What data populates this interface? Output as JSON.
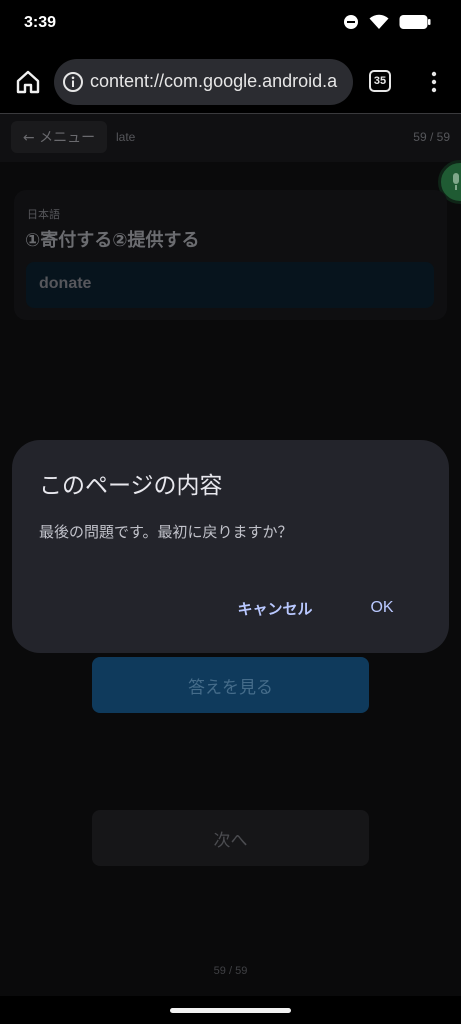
{
  "status_bar": {
    "time": "3:39",
    "icons": [
      "do-not-disturb-icon",
      "wifi-icon",
      "battery-icon"
    ]
  },
  "browser": {
    "url": "content://com.google.android.a",
    "tab_count": "35",
    "icons": [
      "home-icon",
      "site-info-icon",
      "tab-switcher-icon",
      "more-vert-icon"
    ]
  },
  "page": {
    "back_menu_label": "← メニュー",
    "late_label": "late",
    "counter_top": "59 / 59",
    "card": {
      "language_label": "日本語",
      "title": "①寄付する②提供する",
      "answer": "donate"
    },
    "show_answer_label": "答えを見る",
    "next_label": "次へ",
    "counter_bottom": "59 / 59"
  },
  "dialog": {
    "title": "このページの内容",
    "message": "最後の問題です。最初に戻りますか？",
    "cancel_label": "キャンセル",
    "ok_label": "OK"
  },
  "colors": {
    "accent_text": "#b9c8ff",
    "dialog_background": "#23242b"
  }
}
